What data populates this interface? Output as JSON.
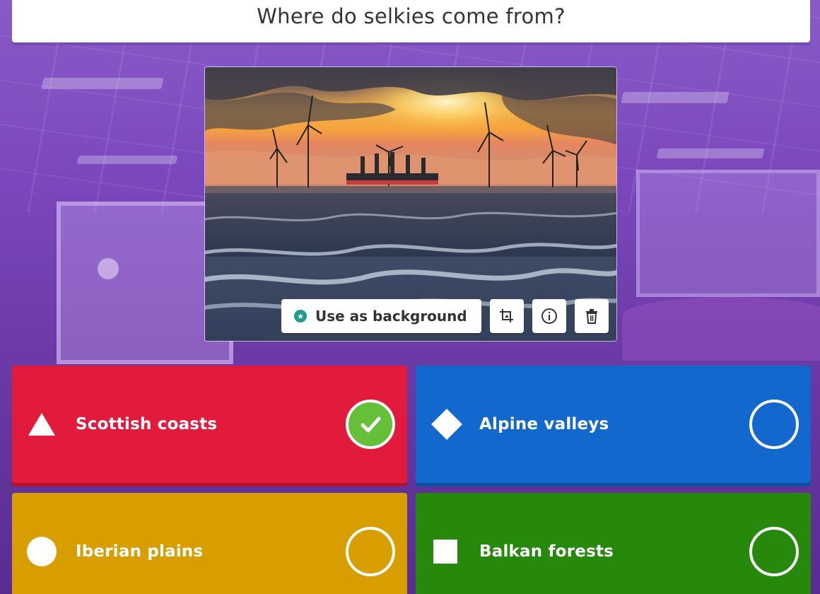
{
  "question": {
    "text": "Where do selkies come from?"
  },
  "media": {
    "image_description_icon": "offshore-wind-farm-sunset-image",
    "toolbar": {
      "use_background_label": "Use as background",
      "use_background_icon": "star-badge-icon",
      "crop_icon": "crop-icon",
      "info_icon": "info-icon",
      "delete_icon": "trash-icon"
    }
  },
  "answers": [
    {
      "label": "Scottish coasts",
      "shape_icon": "triangle-icon",
      "color": "#e21b3c",
      "correct": true
    },
    {
      "label": "Alpine valleys",
      "shape_icon": "diamond-icon",
      "color": "#1368ce",
      "correct": false
    },
    {
      "label": "Iberian plains",
      "shape_icon": "circle-icon",
      "color": "#d89e00",
      "correct": false
    },
    {
      "label": "Balkan forests",
      "shape_icon": "square-icon",
      "color": "#26890c",
      "correct": false
    }
  ],
  "colors": {
    "correct_check": "#66bf39",
    "background": "#7a48bc"
  }
}
